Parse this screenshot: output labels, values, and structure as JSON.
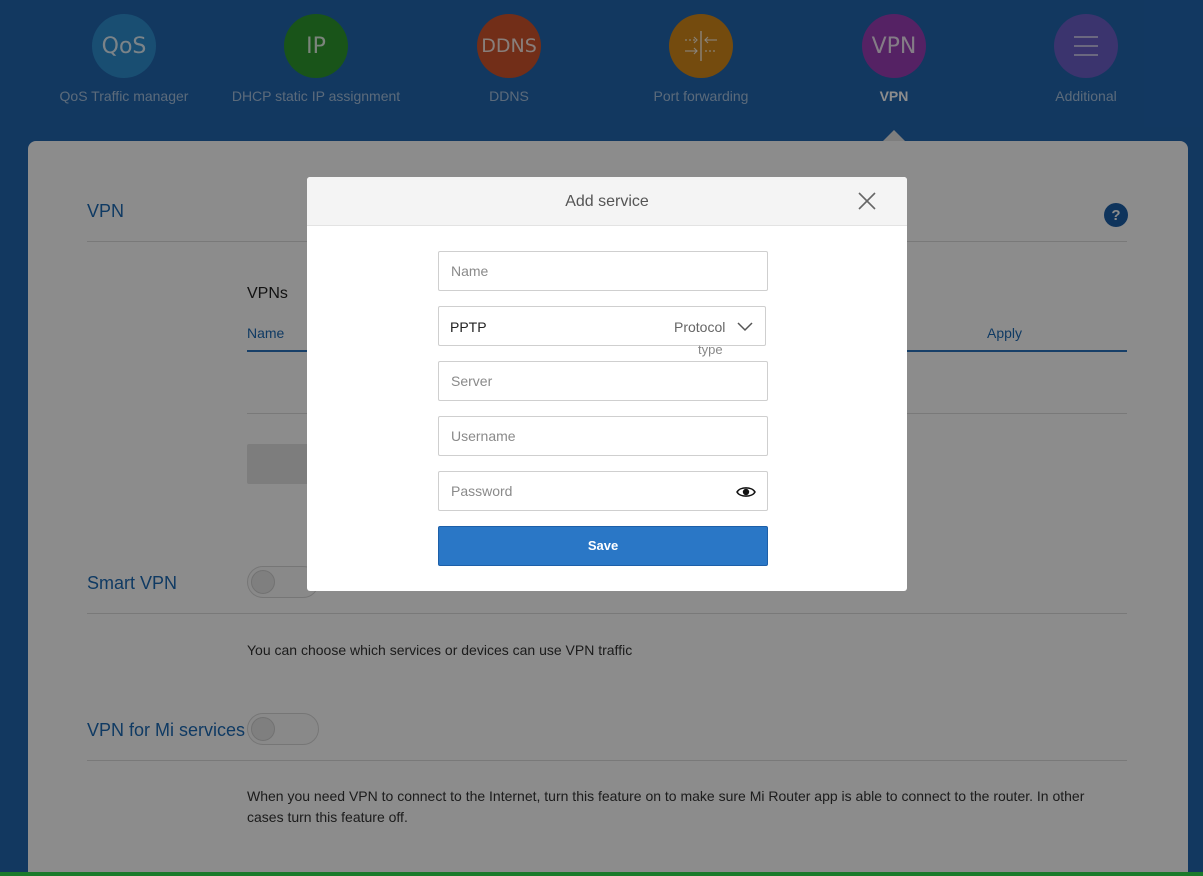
{
  "nav": {
    "items": [
      {
        "icon_text": "QoS",
        "label": "QoS Traffic manager",
        "color": "#2f8fcf"
      },
      {
        "icon_text": "IP",
        "label": "DHCP static IP assignment",
        "color": "#2e9a2e"
      },
      {
        "icon_text": "DDNS",
        "label": "DDNS",
        "color": "#d0542c"
      },
      {
        "icon_text": "",
        "label": "Port forwarding",
        "color": "#d4891a"
      },
      {
        "icon_text": "VPN",
        "label": "VPN",
        "color": "#9b3fb6",
        "active": true
      },
      {
        "icon_text": "",
        "label": "Additional",
        "color": "#6c5fc8"
      }
    ]
  },
  "page": {
    "vpn_title": "VPN",
    "help": "?",
    "vpns_title": "VPNs",
    "table_headers": {
      "name": "Name",
      "apply": "Apply"
    },
    "smart_vpn": {
      "title": "Smart VPN",
      "description": "You can choose which services or devices can use VPN traffic"
    },
    "vpn_mi": {
      "title": "VPN for Mi services",
      "description_line1": "When you need VPN to connect to the Internet, turn this feature on to make sure Mi Router app is able to connect to the router. In other",
      "description_line2": "cases turn this feature off."
    }
  },
  "modal": {
    "title": "Add service",
    "name_placeholder": "Name",
    "protocol_value": "PPTP",
    "protocol_label_line1": "Protocol",
    "protocol_label_line2": "type",
    "server_placeholder": "Server",
    "username_placeholder": "Username",
    "password_placeholder": "Password",
    "save_label": "Save"
  },
  "colors": {
    "background": "#2166b0",
    "accent": "#2a77c6",
    "title_blue": "#1d6ab5"
  }
}
